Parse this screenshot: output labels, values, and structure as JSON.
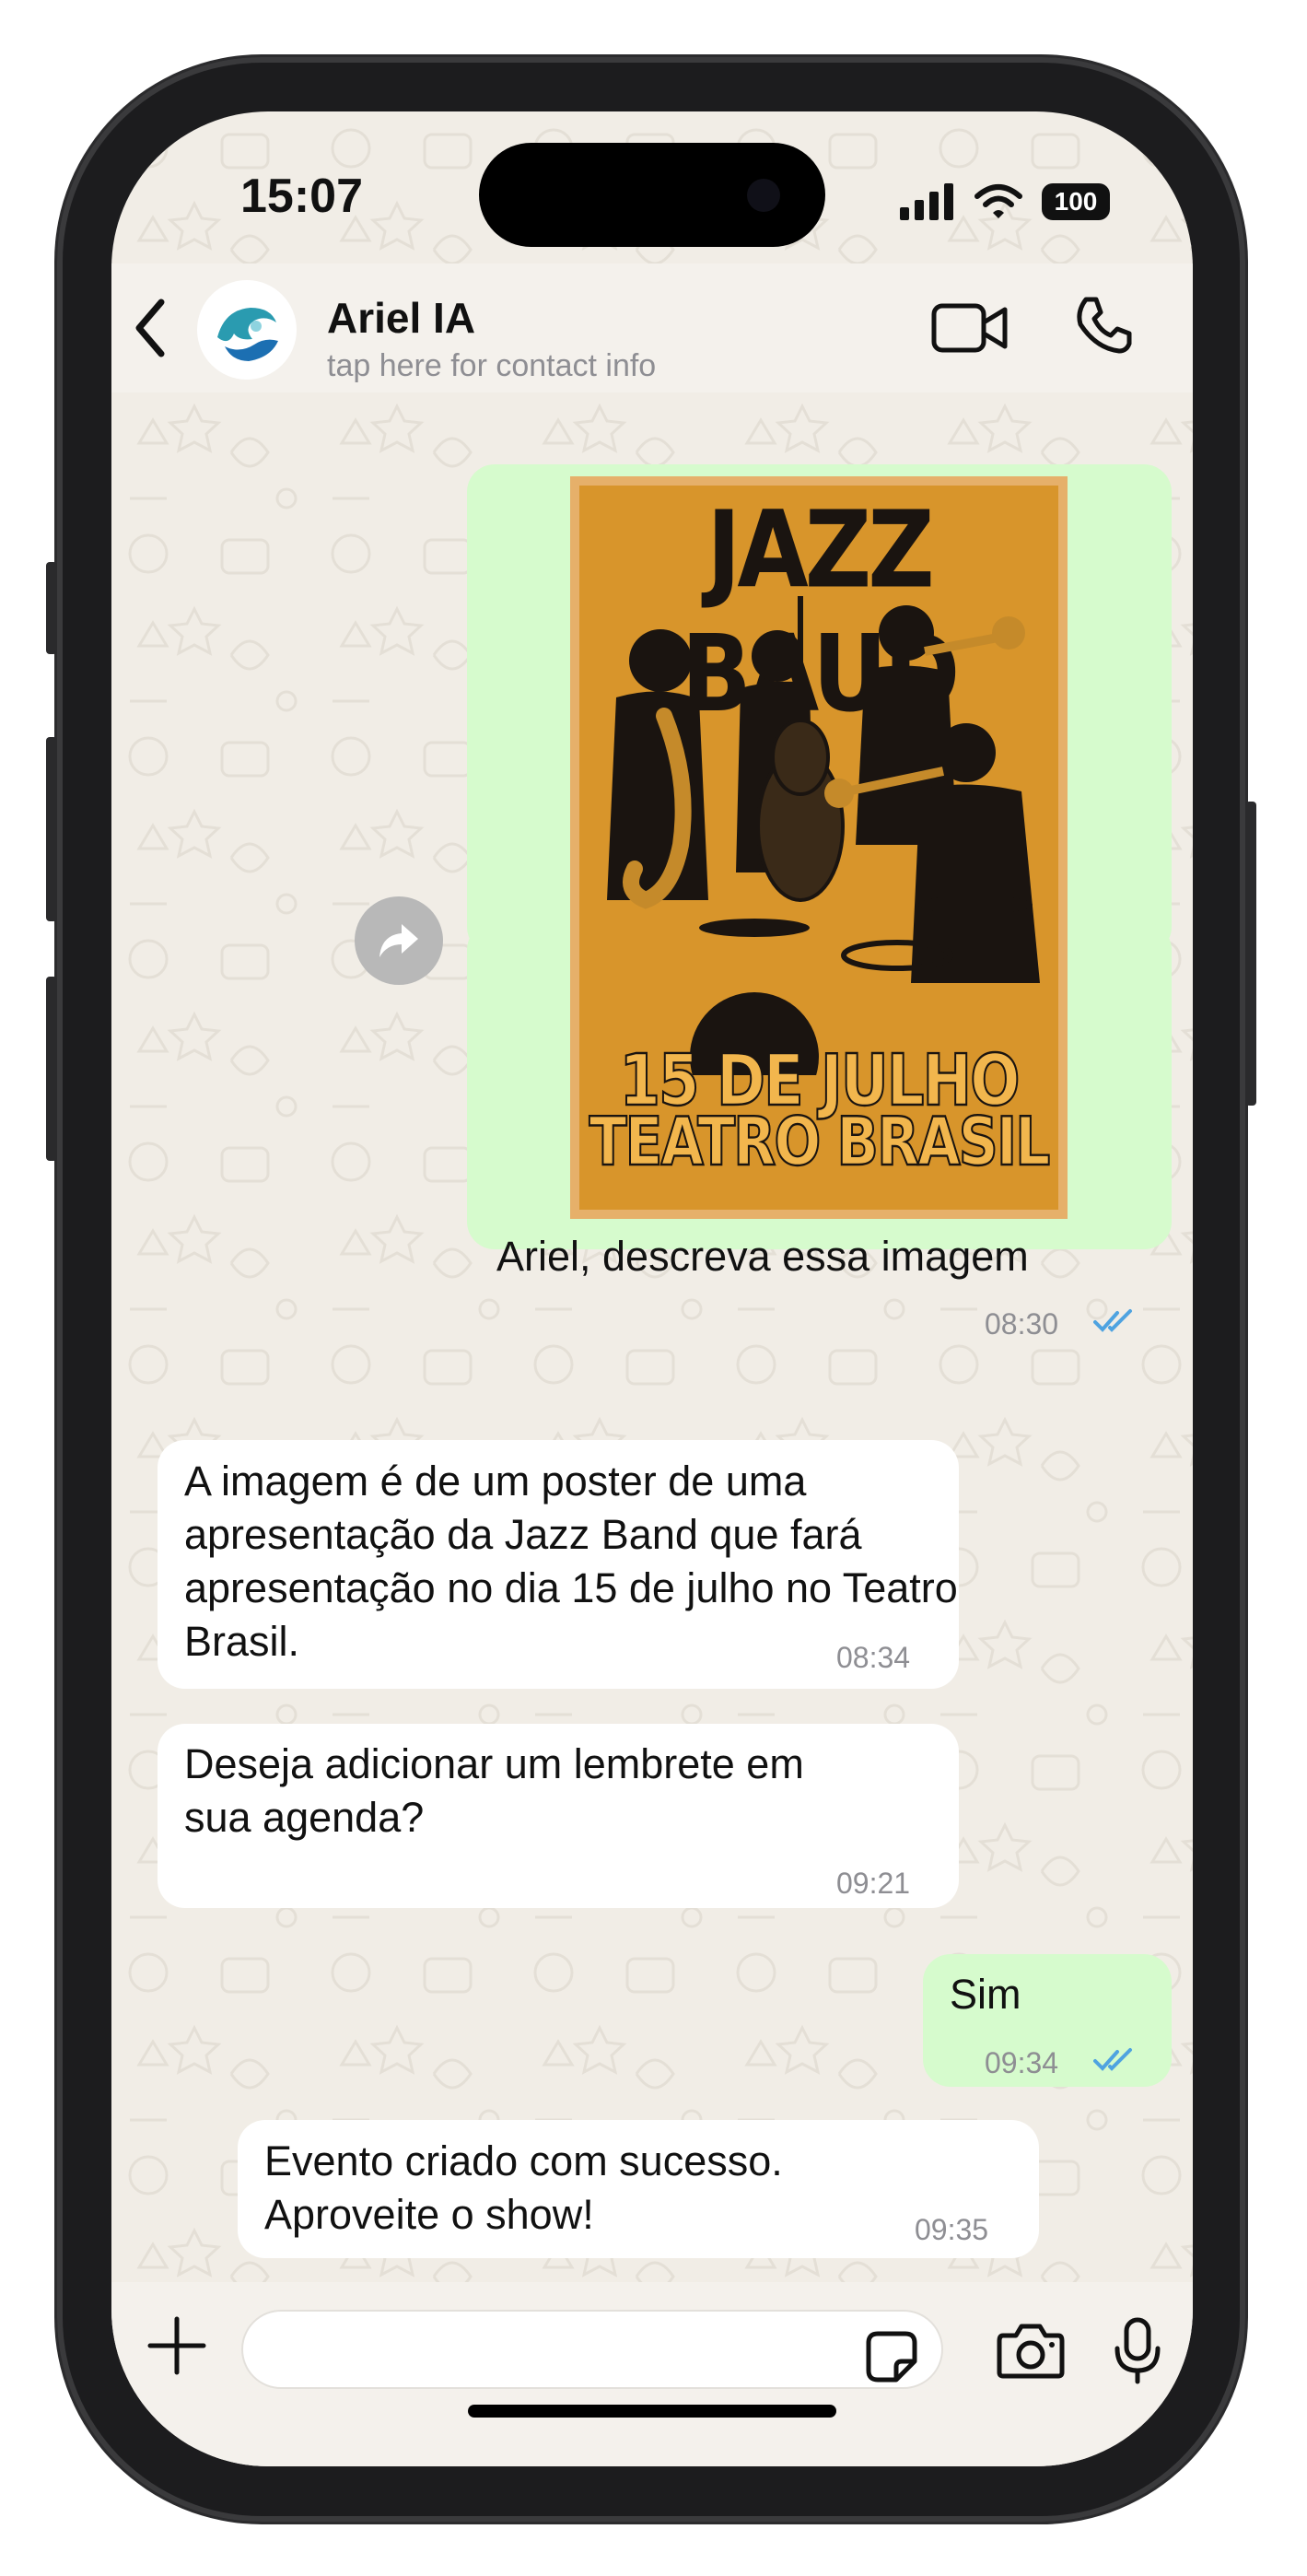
{
  "status_bar": {
    "time": "15:07",
    "battery": "100"
  },
  "header": {
    "contact_name": "Ariel IA",
    "contact_subtitle": "tap here for contact info",
    "icons": {
      "back": "chevron-left-icon",
      "video": "video-camera-icon",
      "call": "phone-icon"
    }
  },
  "poster": {
    "title": "JAZZ BAUD",
    "date": "15 DE JULHO",
    "venue": "TEATRO BRASIL",
    "color": "#d8952b"
  },
  "messages": [
    {
      "direction": "out",
      "text": "Ariel, descreva essa imagem",
      "time": "08:30",
      "read": true,
      "has_image": true
    },
    {
      "direction": "in",
      "text": "A imagem é de um poster de uma apresentação da Jazz Band que fará apresentação no dia 15 de julho no Teatro Brasil.",
      "time": "08:34"
    },
    {
      "direction": "in",
      "text": "Deseja adicionar um lembrete em sua agenda?",
      "time": "09:21"
    },
    {
      "direction": "out",
      "text": "Sim",
      "time": "09:34",
      "read": true
    },
    {
      "direction": "in",
      "text": "Evento criado com sucesso. Aproveite o show!",
      "time": "09:35"
    }
  ],
  "input": {
    "placeholder": ""
  },
  "colors": {
    "outgoing_bubble": "#d6fbcd",
    "incoming_bubble": "#ffffff",
    "read_ticks": "#4fa3e0",
    "chat_bg": "#f1ede6"
  }
}
